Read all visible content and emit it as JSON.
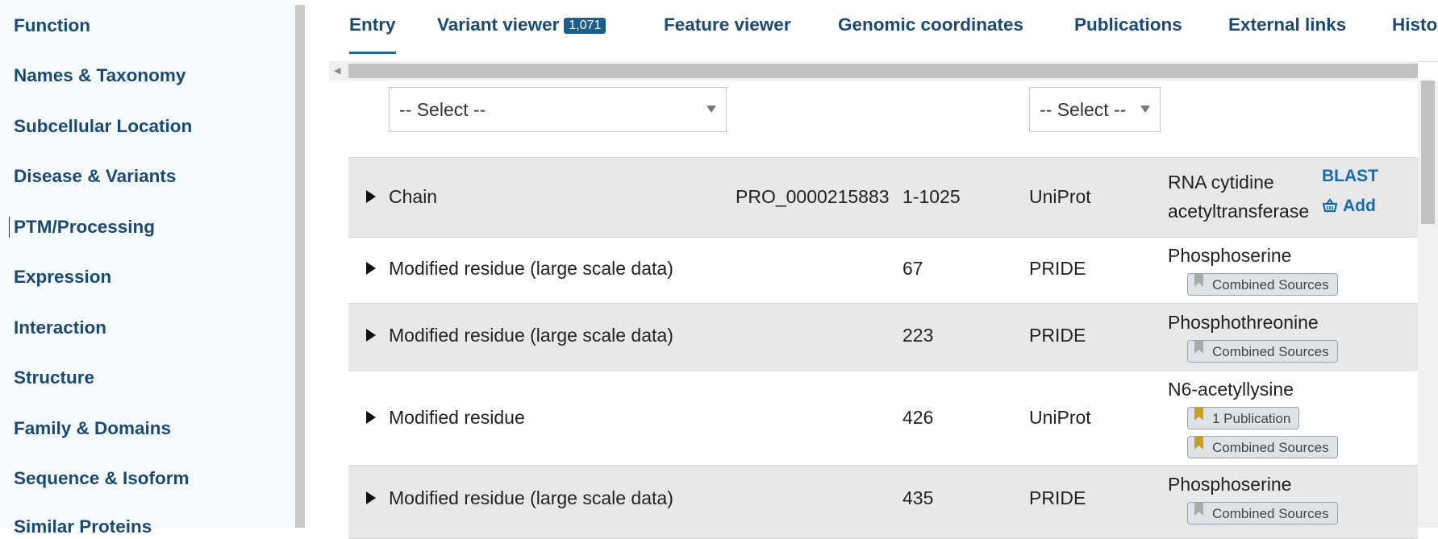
{
  "sidebar": {
    "items": [
      {
        "label": "Function"
      },
      {
        "label": "Names & Taxonomy"
      },
      {
        "label": "Subcellular Location"
      },
      {
        "label": "Disease & Variants"
      },
      {
        "label": "PTM/Processing"
      },
      {
        "label": "Expression"
      },
      {
        "label": "Interaction"
      },
      {
        "label": "Structure"
      },
      {
        "label": "Family & Domains"
      },
      {
        "label": "Sequence & Isoform"
      },
      {
        "label": "Similar Proteins"
      }
    ],
    "active": "PTM/Processing"
  },
  "tabs": [
    {
      "label": "Entry"
    },
    {
      "label": "Variant viewer",
      "badge": "1,071"
    },
    {
      "label": "Feature viewer"
    },
    {
      "label": "Genomic coordinates"
    },
    {
      "label": "Publications"
    },
    {
      "label": "External links"
    },
    {
      "label": "Histo"
    }
  ],
  "filters": {
    "select1": "-- Select --",
    "select2": "-- Select --"
  },
  "rows": [
    {
      "type": "Chain",
      "id": "PRO_0000215883",
      "position": "1-1025",
      "source": "UniProt",
      "desc1": "RNA cytidine",
      "desc2": "acetyltransferase",
      "blast": "BLAST",
      "add": "Add"
    },
    {
      "type": "Modified residue (large scale data)",
      "position": "67",
      "source": "PRIDE",
      "desc": "Phosphoserine",
      "tag": "Combined Sources"
    },
    {
      "type": "Modified residue (large scale data)",
      "position": "223",
      "source": "PRIDE",
      "desc": "Phosphothreonine",
      "tag": "Combined Sources"
    },
    {
      "type": "Modified residue",
      "position": "426",
      "source": "UniProt",
      "desc": "N6-acetyllysine",
      "tag1": "1 Publication",
      "tag2": "Combined Sources"
    },
    {
      "type": "Modified residue (large scale data)",
      "position": "435",
      "source": "PRIDE",
      "desc": "Phosphoserine",
      "tag": "Combined Sources"
    }
  ],
  "colors": {
    "link": "#1a4a73",
    "badge": "#1d5f8a",
    "row_shade": "#e6e8ea",
    "bookmark_gold": "#c9a21a",
    "bookmark_grey": "#aaaaaa"
  },
  "icons": {
    "expand": "triangle-right-icon",
    "basket": "basket-icon",
    "bookmark": "bookmark-icon"
  }
}
